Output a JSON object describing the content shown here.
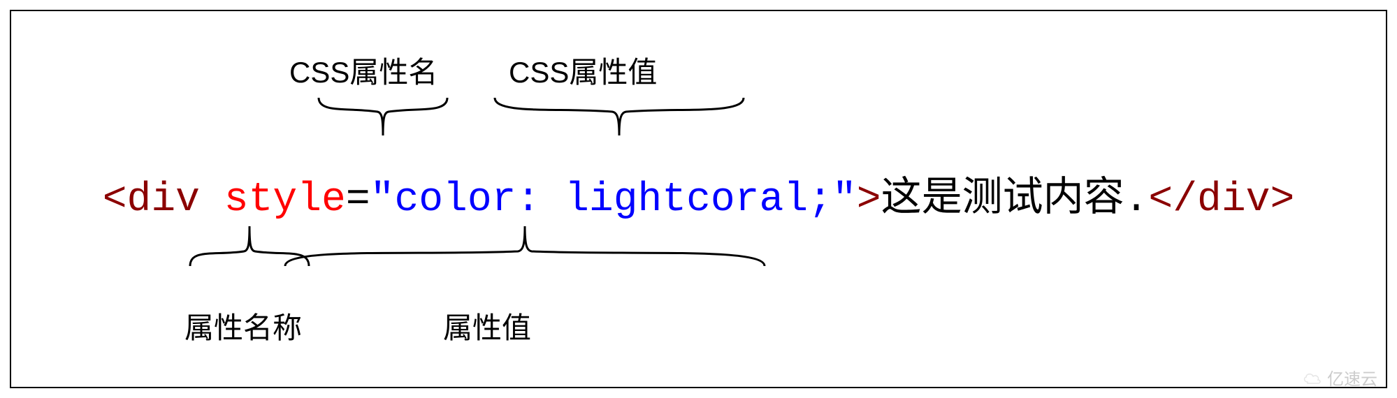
{
  "code": {
    "open_tag_lt": "<",
    "tag_name": "div",
    "space1": " ",
    "attr_name": "style",
    "equals": "=",
    "quote_open": "\"",
    "css_prop": "color",
    "css_colon": ": ",
    "css_value": "lightcoral",
    "css_semicolon": ";",
    "quote_close": "\"",
    "open_tag_gt": ">",
    "inner_text": "这是测试内容.",
    "close_tag_lt": "<",
    "close_slash": "/",
    "close_tag_name": "div",
    "close_tag_gt": ">"
  },
  "labels": {
    "css_prop_name": "CSS属性名",
    "css_prop_value": "CSS属性值",
    "attr_name_label": "属性名称",
    "attr_value_label": "属性值"
  },
  "watermark": "亿速云"
}
